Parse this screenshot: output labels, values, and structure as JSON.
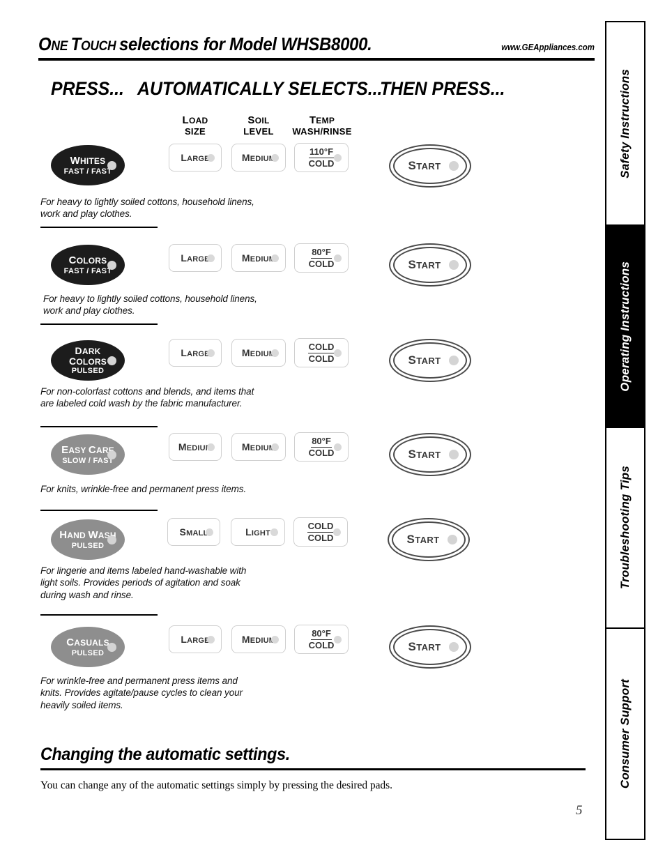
{
  "header": {
    "title_main": "NE",
    "title_full": "ONE TOUCH selections for Model WHSB8000.",
    "title_a": "O",
    "title_b": "NE ",
    "title_c": "T",
    "title_d": "OUCH ",
    "title_e": "selections for Model WHSB8000.",
    "website": "www.GEAppliances.com"
  },
  "columns": {
    "press": "PRESS...",
    "automatically_selects": "AUTOMATICALLY SELECTS...",
    "then_press": "THEN PRESS..."
  },
  "setting_headers": [
    {
      "line1_cap": "L",
      "line1_rest": "OAD",
      "line2": "SIZE"
    },
    {
      "line1_cap": "S",
      "line1_rest": "OIL",
      "line2": "LEVEL"
    },
    {
      "line1_cap": "T",
      "line1_rest": "EMP",
      "line2": "WASH/RINSE"
    }
  ],
  "start_button": {
    "cap": "S",
    "rest": "TART"
  },
  "rows": [
    {
      "cycle": {
        "name_cap": "W",
        "name_rest": "HITES",
        "sub": "FAST / FAST",
        "style": "black"
      },
      "load": {
        "cap": "L",
        "rest": "ARGE"
      },
      "soil": {
        "cap": "M",
        "rest": "EDIUM"
      },
      "temp": {
        "line1": "110°F",
        "line2": "COLD"
      },
      "description": "For heavy to lightly soiled cottons, household linens,\nwork and play clothes."
    },
    {
      "cycle": {
        "name_cap": "C",
        "name_rest": "OLORS",
        "sub": "FAST / FAST",
        "style": "black"
      },
      "load": {
        "cap": "L",
        "rest": "ARGE"
      },
      "soil": {
        "cap": "M",
        "rest": "EDIUM"
      },
      "temp": {
        "line1": "80°F",
        "line2": "COLD"
      },
      "description": "For heavy to lightly soiled cottons, household linens,\nwork and play clothes."
    },
    {
      "cycle": {
        "name_cap": "D",
        "name_rest": "ARK",
        "name2_cap": "C",
        "name2_rest": "OLORS",
        "sub": "PULSED",
        "style": "black"
      },
      "load": {
        "cap": "L",
        "rest": "ARGE"
      },
      "soil": {
        "cap": "M",
        "rest": "EDIUM"
      },
      "temp": {
        "line1": "COLD",
        "line2": "COLD"
      },
      "description": "For non-colorfast cottons and blends, and items that\nare labeled cold wash by the fabric manufacturer."
    },
    {
      "cycle": {
        "name_cap": "E",
        "name_rest": "ASY ",
        "name_cap2": "C",
        "name_rest2": "ARE",
        "sub": "SLOW / FAST",
        "style": "gray"
      },
      "load": {
        "cap": "M",
        "rest": "EDIUM"
      },
      "soil": {
        "cap": "M",
        "rest": "EDIUM"
      },
      "temp": {
        "line1": "80°F",
        "line2": "COLD"
      },
      "description": "For knits, wrinkle-free and permanent press items."
    },
    {
      "cycle": {
        "name_cap": "H",
        "name_rest": "AND ",
        "name_cap2": "W",
        "name_rest2": "ASH",
        "sub": "PULSED",
        "style": "gray"
      },
      "load": {
        "cap": "S",
        "rest": "MALL"
      },
      "soil": {
        "cap": "L",
        "rest": "IGHT"
      },
      "temp": {
        "line1": "COLD",
        "line2": "COLD"
      },
      "description": "For lingerie and items labeled hand-washable with\nlight soils. Provides periods of agitation and soak\nduring wash and rinse."
    },
    {
      "cycle": {
        "name_cap": "C",
        "name_rest": "ASUALS",
        "sub": "PULSED",
        "style": "gray"
      },
      "load": {
        "cap": "L",
        "rest": "ARGE"
      },
      "soil": {
        "cap": "M",
        "rest": "EDIUM"
      },
      "temp": {
        "line1": "80°F",
        "line2": "COLD"
      },
      "description": "For wrinkle-free and permanent press items and\nknits. Provides agitate/pause cycles to clean your\nheavily soiled items."
    }
  ],
  "bottom": {
    "title": "Changing the automatic settings.",
    "body": "You can change any of the automatic settings simply by pressing the desired pads."
  },
  "side_tabs": [
    {
      "label": "Safety Instructions",
      "active": false
    },
    {
      "label": "Operating Instructions",
      "active": true
    },
    {
      "label": "Troubleshooting Tips",
      "active": false
    },
    {
      "label": "Consumer Support",
      "active": false
    }
  ],
  "page_number": "5",
  "colors": {
    "black_oval": "#1c1c1c",
    "gray_oval": "#8e8e8e",
    "pad_border": "#cfcfcf",
    "dot": "#d4d4d4",
    "start_ring": "#4a4a4a"
  }
}
